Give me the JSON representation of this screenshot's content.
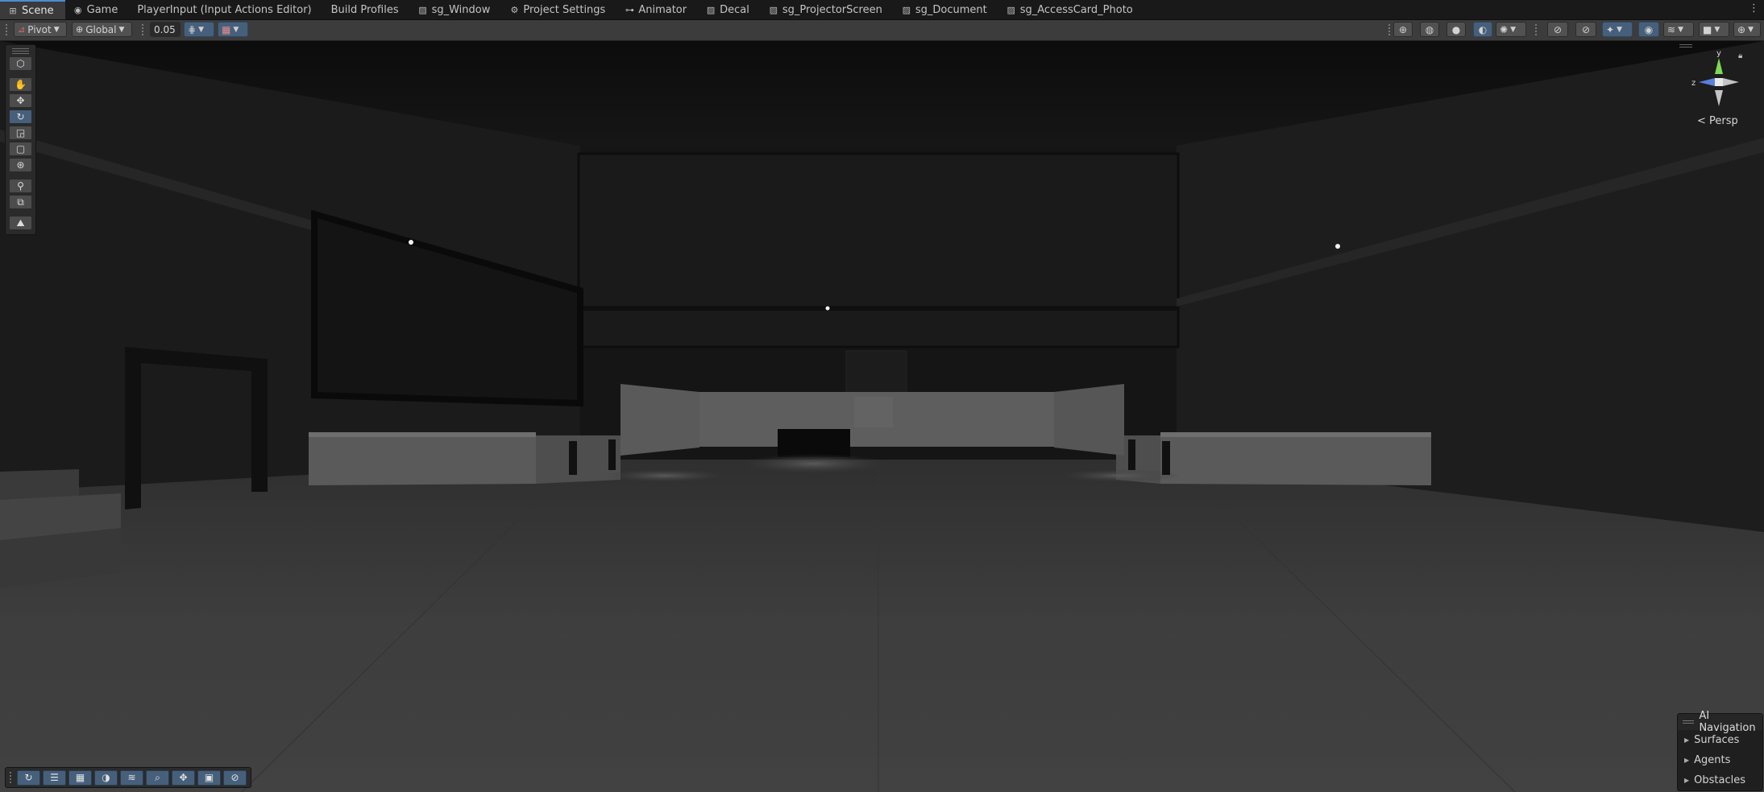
{
  "tabs": [
    {
      "label": "Scene",
      "icon": "scene-icon",
      "glyph": "⊞",
      "active": true
    },
    {
      "label": "Game",
      "icon": "gamepad-icon",
      "glyph": "◉"
    },
    {
      "label": "PlayerInput (Input Actions Editor)",
      "icon": "",
      "glyph": ""
    },
    {
      "label": "Build Profiles",
      "icon": "",
      "glyph": ""
    },
    {
      "label": "sg_Window",
      "icon": "shadergraph-icon",
      "glyph": "▨"
    },
    {
      "label": "Project Settings",
      "icon": "gear-icon",
      "glyph": "⚙"
    },
    {
      "label": "Animator",
      "icon": "animator-icon",
      "glyph": "⊶"
    },
    {
      "label": "Decal",
      "icon": "shadergraph-icon",
      "glyph": "▨"
    },
    {
      "label": "sg_ProjectorScreen",
      "icon": "shadergraph-icon",
      "glyph": "▨"
    },
    {
      "label": "sg_Document",
      "icon": "shadergraph-icon",
      "glyph": "▨"
    },
    {
      "label": "sg_AccessCard_Photo",
      "icon": "shadergraph-icon",
      "glyph": "▨"
    }
  ],
  "tab_more": "⋮",
  "toolbar": {
    "pivot_label": "Pivot",
    "global_label": "Global",
    "snap_value": "0.05"
  },
  "gizmo": {
    "y_label": "y",
    "z_label": "z",
    "persp_label": "< Persp"
  },
  "ai_navigation": {
    "title": "AI Navigation",
    "items": [
      "Surfaces",
      "Agents",
      "Obstacles"
    ]
  },
  "colors": {
    "accent": "#46607c",
    "active_tab_border": "#4a8dd6",
    "gizmo_y": "#7fd957",
    "gizmo_z": "#5b7fe0"
  }
}
